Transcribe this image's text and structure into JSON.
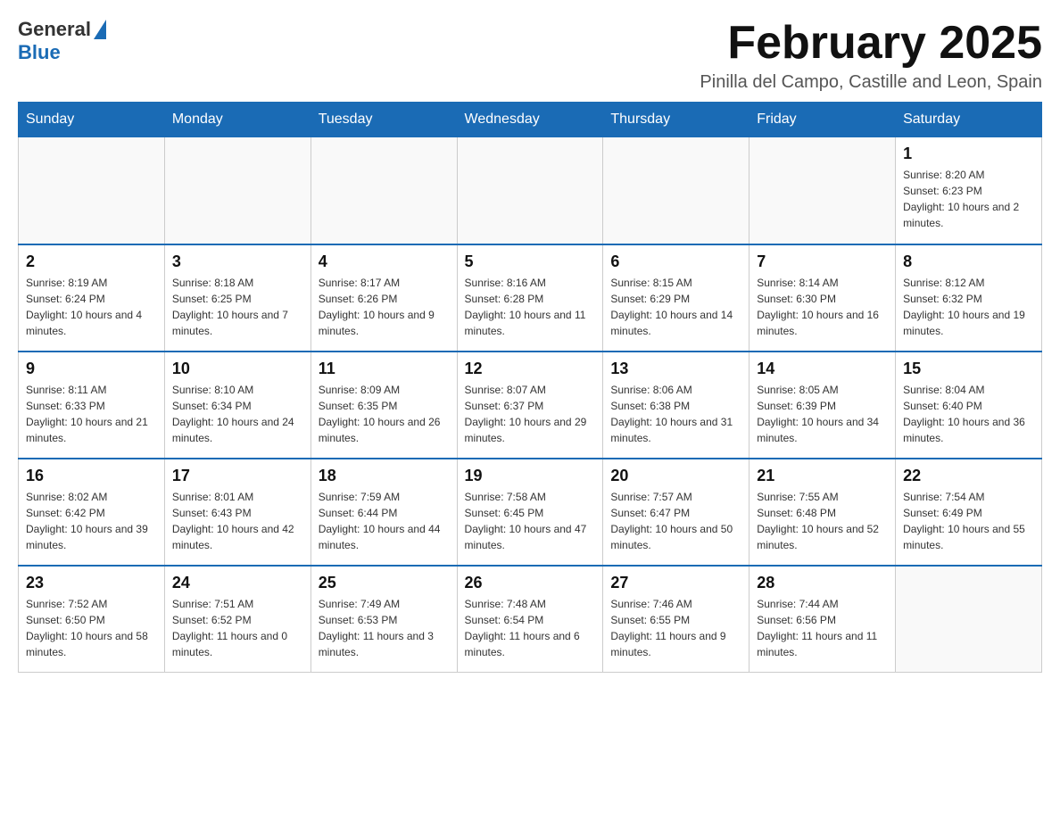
{
  "header": {
    "logo_general": "General",
    "logo_blue": "Blue",
    "month_title": "February 2025",
    "location": "Pinilla del Campo, Castille and Leon, Spain"
  },
  "days_of_week": [
    "Sunday",
    "Monday",
    "Tuesday",
    "Wednesday",
    "Thursday",
    "Friday",
    "Saturday"
  ],
  "weeks": [
    [
      {
        "day": "",
        "info": ""
      },
      {
        "day": "",
        "info": ""
      },
      {
        "day": "",
        "info": ""
      },
      {
        "day": "",
        "info": ""
      },
      {
        "day": "",
        "info": ""
      },
      {
        "day": "",
        "info": ""
      },
      {
        "day": "1",
        "info": "Sunrise: 8:20 AM\nSunset: 6:23 PM\nDaylight: 10 hours and 2 minutes."
      }
    ],
    [
      {
        "day": "2",
        "info": "Sunrise: 8:19 AM\nSunset: 6:24 PM\nDaylight: 10 hours and 4 minutes."
      },
      {
        "day": "3",
        "info": "Sunrise: 8:18 AM\nSunset: 6:25 PM\nDaylight: 10 hours and 7 minutes."
      },
      {
        "day": "4",
        "info": "Sunrise: 8:17 AM\nSunset: 6:26 PM\nDaylight: 10 hours and 9 minutes."
      },
      {
        "day": "5",
        "info": "Sunrise: 8:16 AM\nSunset: 6:28 PM\nDaylight: 10 hours and 11 minutes."
      },
      {
        "day": "6",
        "info": "Sunrise: 8:15 AM\nSunset: 6:29 PM\nDaylight: 10 hours and 14 minutes."
      },
      {
        "day": "7",
        "info": "Sunrise: 8:14 AM\nSunset: 6:30 PM\nDaylight: 10 hours and 16 minutes."
      },
      {
        "day": "8",
        "info": "Sunrise: 8:12 AM\nSunset: 6:32 PM\nDaylight: 10 hours and 19 minutes."
      }
    ],
    [
      {
        "day": "9",
        "info": "Sunrise: 8:11 AM\nSunset: 6:33 PM\nDaylight: 10 hours and 21 minutes."
      },
      {
        "day": "10",
        "info": "Sunrise: 8:10 AM\nSunset: 6:34 PM\nDaylight: 10 hours and 24 minutes."
      },
      {
        "day": "11",
        "info": "Sunrise: 8:09 AM\nSunset: 6:35 PM\nDaylight: 10 hours and 26 minutes."
      },
      {
        "day": "12",
        "info": "Sunrise: 8:07 AM\nSunset: 6:37 PM\nDaylight: 10 hours and 29 minutes."
      },
      {
        "day": "13",
        "info": "Sunrise: 8:06 AM\nSunset: 6:38 PM\nDaylight: 10 hours and 31 minutes."
      },
      {
        "day": "14",
        "info": "Sunrise: 8:05 AM\nSunset: 6:39 PM\nDaylight: 10 hours and 34 minutes."
      },
      {
        "day": "15",
        "info": "Sunrise: 8:04 AM\nSunset: 6:40 PM\nDaylight: 10 hours and 36 minutes."
      }
    ],
    [
      {
        "day": "16",
        "info": "Sunrise: 8:02 AM\nSunset: 6:42 PM\nDaylight: 10 hours and 39 minutes."
      },
      {
        "day": "17",
        "info": "Sunrise: 8:01 AM\nSunset: 6:43 PM\nDaylight: 10 hours and 42 minutes."
      },
      {
        "day": "18",
        "info": "Sunrise: 7:59 AM\nSunset: 6:44 PM\nDaylight: 10 hours and 44 minutes."
      },
      {
        "day": "19",
        "info": "Sunrise: 7:58 AM\nSunset: 6:45 PM\nDaylight: 10 hours and 47 minutes."
      },
      {
        "day": "20",
        "info": "Sunrise: 7:57 AM\nSunset: 6:47 PM\nDaylight: 10 hours and 50 minutes."
      },
      {
        "day": "21",
        "info": "Sunrise: 7:55 AM\nSunset: 6:48 PM\nDaylight: 10 hours and 52 minutes."
      },
      {
        "day": "22",
        "info": "Sunrise: 7:54 AM\nSunset: 6:49 PM\nDaylight: 10 hours and 55 minutes."
      }
    ],
    [
      {
        "day": "23",
        "info": "Sunrise: 7:52 AM\nSunset: 6:50 PM\nDaylight: 10 hours and 58 minutes."
      },
      {
        "day": "24",
        "info": "Sunrise: 7:51 AM\nSunset: 6:52 PM\nDaylight: 11 hours and 0 minutes."
      },
      {
        "day": "25",
        "info": "Sunrise: 7:49 AM\nSunset: 6:53 PM\nDaylight: 11 hours and 3 minutes."
      },
      {
        "day": "26",
        "info": "Sunrise: 7:48 AM\nSunset: 6:54 PM\nDaylight: 11 hours and 6 minutes."
      },
      {
        "day": "27",
        "info": "Sunrise: 7:46 AM\nSunset: 6:55 PM\nDaylight: 11 hours and 9 minutes."
      },
      {
        "day": "28",
        "info": "Sunrise: 7:44 AM\nSunset: 6:56 PM\nDaylight: 11 hours and 11 minutes."
      },
      {
        "day": "",
        "info": ""
      }
    ]
  ]
}
